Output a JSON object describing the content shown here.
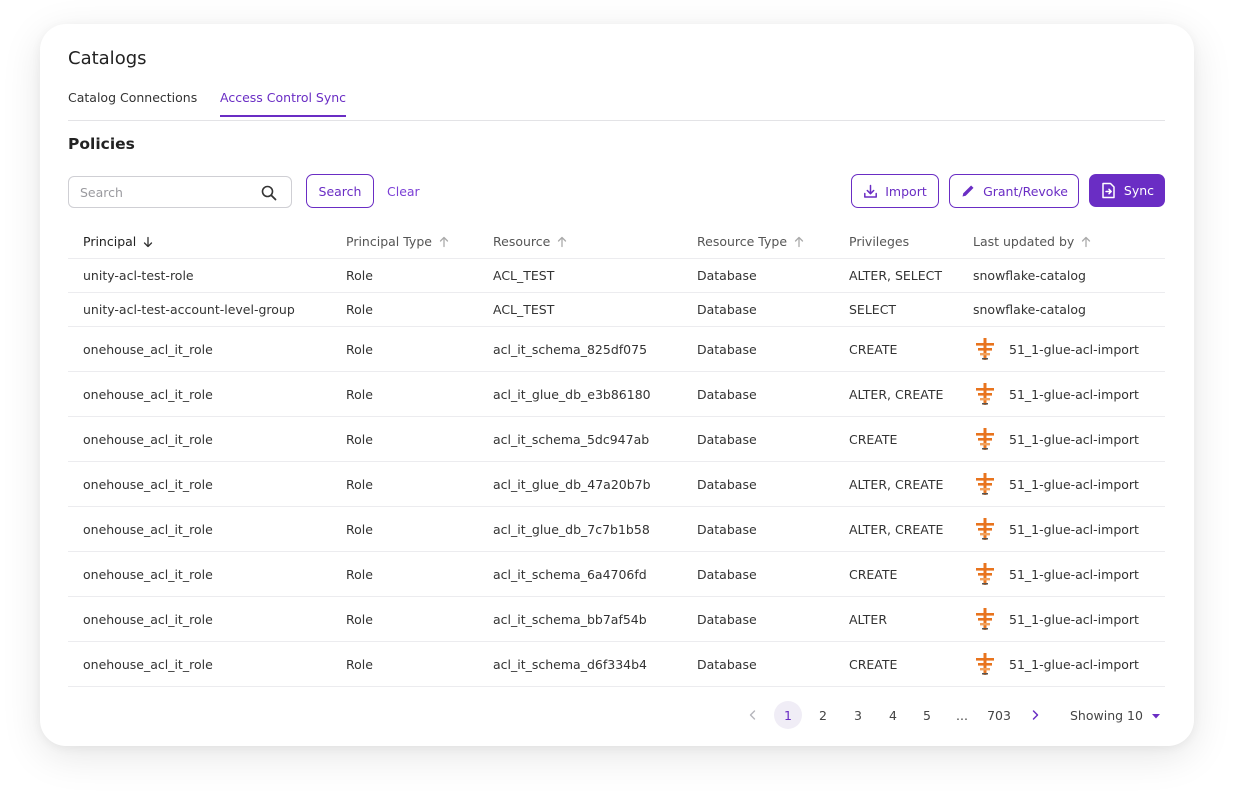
{
  "page": {
    "title": "Catalogs"
  },
  "tabs": [
    {
      "label": "Catalog Connections",
      "active": false
    },
    {
      "label": "Access Control Sync",
      "active": true
    }
  ],
  "section": {
    "title": "Policies"
  },
  "toolbar": {
    "search_placeholder": "Search",
    "search_value": "",
    "search_button": "Search",
    "clear_link": "Clear",
    "import_button": "Import",
    "grant_button": "Grant/Revoke",
    "sync_button": "Sync"
  },
  "table": {
    "headers": [
      "Principal",
      "Principal Type",
      "Resource",
      "Resource Type",
      "Privileges",
      "Last updated by"
    ],
    "sort": {
      "Principal": "desc"
    },
    "rows": [
      {
        "principal": "unity-acl-test-role",
        "principal_type": "Role",
        "resource": "ACL_TEST",
        "resource_type": "Database",
        "privileges": "ALTER, SELECT",
        "updated_by": "snowflake-catalog",
        "updated_by_icon": ""
      },
      {
        "principal": "unity-acl-test-account-level-group",
        "principal_type": "Role",
        "resource": "ACL_TEST",
        "resource_type": "Database",
        "privileges": "SELECT",
        "updated_by": "snowflake-catalog",
        "updated_by_icon": ""
      },
      {
        "principal": "onehouse_acl_it_role",
        "principal_type": "Role",
        "resource": "acl_it_schema_825df075",
        "resource_type": "Database",
        "privileges": "CREATE",
        "updated_by": "51_1-glue-acl-import",
        "updated_by_icon": "aws-glue-icon"
      },
      {
        "principal": "onehouse_acl_it_role",
        "principal_type": "Role",
        "resource": "acl_it_glue_db_e3b86180",
        "resource_type": "Database",
        "privileges": "ALTER, CREATE",
        "updated_by": "51_1-glue-acl-import",
        "updated_by_icon": "aws-glue-icon"
      },
      {
        "principal": "onehouse_acl_it_role",
        "principal_type": "Role",
        "resource": "acl_it_schema_5dc947ab",
        "resource_type": "Database",
        "privileges": "CREATE",
        "updated_by": "51_1-glue-acl-import",
        "updated_by_icon": "aws-glue-icon"
      },
      {
        "principal": "onehouse_acl_it_role",
        "principal_type": "Role",
        "resource": "acl_it_glue_db_47a20b7b",
        "resource_type": "Database",
        "privileges": "ALTER, CREATE",
        "updated_by": "51_1-glue-acl-import",
        "updated_by_icon": "aws-glue-icon"
      },
      {
        "principal": "onehouse_acl_it_role",
        "principal_type": "Role",
        "resource": "acl_it_glue_db_7c7b1b58",
        "resource_type": "Database",
        "privileges": "ALTER, CREATE",
        "updated_by": "51_1-glue-acl-import",
        "updated_by_icon": "aws-glue-icon"
      },
      {
        "principal": "onehouse_acl_it_role",
        "principal_type": "Role",
        "resource": "acl_it_schema_6a4706fd",
        "resource_type": "Database",
        "privileges": "CREATE",
        "updated_by": "51_1-glue-acl-import",
        "updated_by_icon": "aws-glue-icon"
      },
      {
        "principal": "onehouse_acl_it_role",
        "principal_type": "Role",
        "resource": "acl_it_schema_bb7af54b",
        "resource_type": "Database",
        "privileges": "ALTER",
        "updated_by": "51_1-glue-acl-import",
        "updated_by_icon": "aws-glue-icon"
      },
      {
        "principal": "onehouse_acl_it_role",
        "principal_type": "Role",
        "resource": "acl_it_schema_d6f334b4",
        "resource_type": "Database",
        "privileges": "CREATE",
        "updated_by": "51_1-glue-acl-import",
        "updated_by_icon": "aws-glue-icon"
      }
    ]
  },
  "pagination": {
    "pages": [
      "1",
      "2",
      "3",
      "4",
      "5",
      "...",
      "703"
    ],
    "current": "1",
    "showing": "Showing 10"
  },
  "colors": {
    "accent": "#6a2dc4",
    "glue": "#e8741e"
  }
}
